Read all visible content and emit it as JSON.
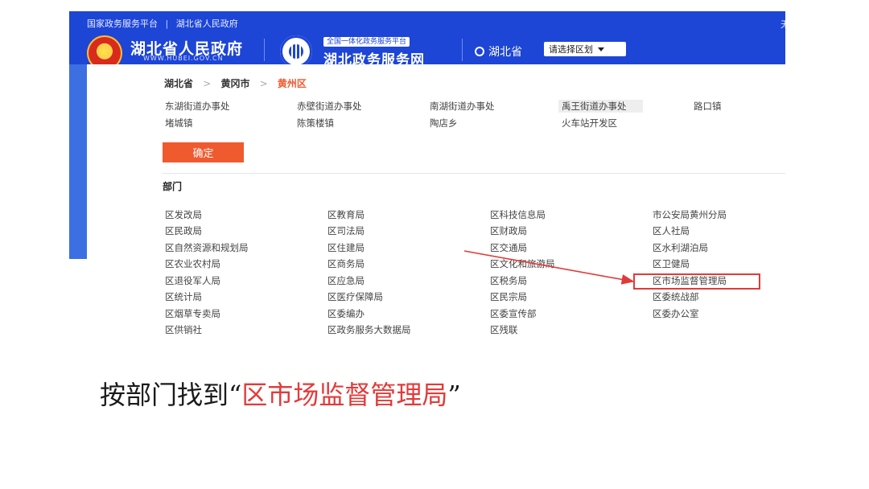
{
  "header": {
    "top_links": [
      "国家政务服务平台",
      "湖北省人民政府"
    ],
    "top_links_separator": "|",
    "gov_name": "湖北省人民政府",
    "gov_url": "WWW.HUBEI.GOV.CN",
    "service_tag": "全国一体化政务服务平台",
    "service_name": "湖北政务服务网",
    "location": "湖北省",
    "region_select_label": "请选择区划",
    "edge_text": "无"
  },
  "breadcrumb": {
    "province": "湖北省",
    "city": "黄冈市",
    "district": "黄州区",
    "arrow": ">"
  },
  "streets": [
    [
      "东湖街道办事处",
      "赤壁街道办事处",
      "南湖街道办事处",
      "禹王街道办事处",
      "路口镇"
    ],
    [
      "堵城镇",
      "陈策楼镇",
      "陶店乡",
      "火车站开发区"
    ]
  ],
  "selected_street": "禹王街道办事处",
  "confirm_label": "确定",
  "department_heading": "部门",
  "departments": [
    [
      "区发改局",
      "区教育局",
      "区科技信息局",
      "市公安局黄州分局"
    ],
    [
      "区民政局",
      "区司法局",
      "区财政局",
      "区人社局"
    ],
    [
      "区自然资源和规划局",
      "区住建局",
      "区交通局",
      "区水利湖泊局"
    ],
    [
      "区农业农村局",
      "区商务局",
      "区文化和旅游局",
      "区卫健局"
    ],
    [
      "区退役军人局",
      "区应急局",
      "区税务局",
      "区市场监督管理局"
    ],
    [
      "区统计局",
      "区医疗保障局",
      "区民宗局",
      "区委统战部"
    ],
    [
      "区烟草专卖局",
      "区委编办",
      "区委宣传部",
      "区委办公室"
    ],
    [
      "区供销社",
      "区政务服务大数据局",
      "区残联"
    ]
  ],
  "highlighted_department": "区市场监督管理局",
  "caption": {
    "prefix": "按部门找到“",
    "highlight": "区市场监督管理局",
    "suffix": "”"
  },
  "colors": {
    "header_blue": "#1d45d6",
    "accent_orange": "#ef5a2f",
    "highlight_red": "#e23a3a"
  }
}
